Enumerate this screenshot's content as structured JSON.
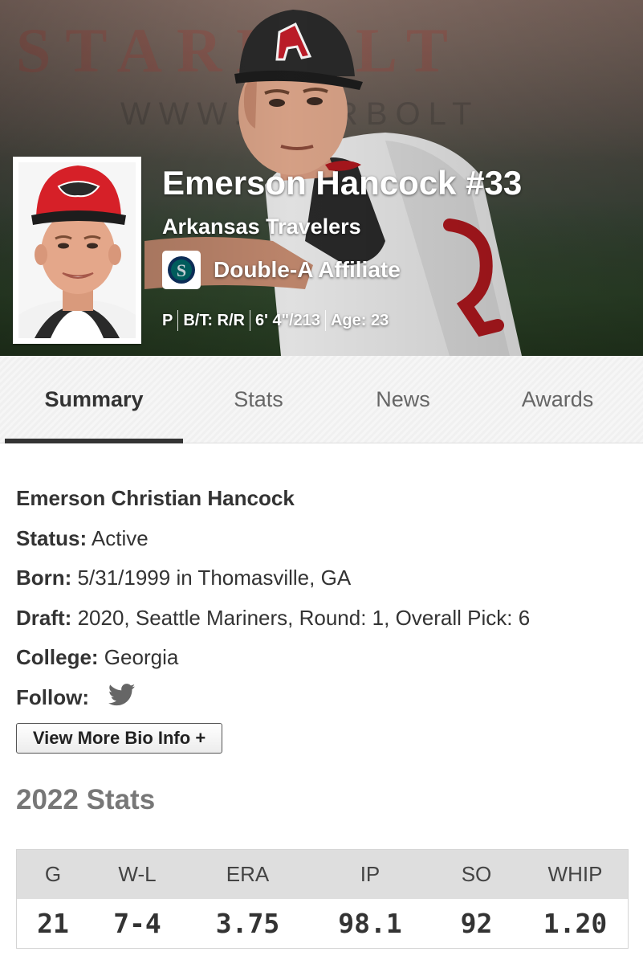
{
  "player": {
    "name_number": "Emerson Hancock #33",
    "team": "Arkansas Travelers",
    "affiliate": "Double-A Affiliate",
    "affiliate_logo": "seattle-mariners-logo",
    "position": "P",
    "bats_throws": "B/T: R/R",
    "height_weight": "6' 4\"/213",
    "age": "Age: 23"
  },
  "tabs": [
    {
      "label": "Summary",
      "active": true
    },
    {
      "label": "Stats",
      "active": false
    },
    {
      "label": "News",
      "active": false
    },
    {
      "label": "Awards",
      "active": false
    }
  ],
  "bio": {
    "full_name": "Emerson Christian Hancock",
    "status_label": "Status:",
    "status_value": " Active",
    "born_label": "Born:",
    "born_value": " 5/31/1999 in Thomasville, GA",
    "draft_label": "Draft:",
    "draft_value": " 2020, Seattle Mariners, Round: 1, Overall Pick: 6",
    "college_label": "College:",
    "college_value": " Georgia",
    "follow_label": "Follow:",
    "follow_icon": "twitter-icon",
    "more_button": "View More Bio Info +"
  },
  "stats": {
    "title": "2022 Stats",
    "headers": [
      "G",
      "W-L",
      "ERA",
      "IP",
      "SO",
      "WHIP"
    ],
    "values": [
      "21",
      "7-4",
      "3.75",
      "98.1",
      "92",
      "1.20"
    ]
  },
  "colors": {
    "tab_active_underline": "#333333",
    "stats_header_bg": "#dedede",
    "stats_title": "#777777"
  }
}
